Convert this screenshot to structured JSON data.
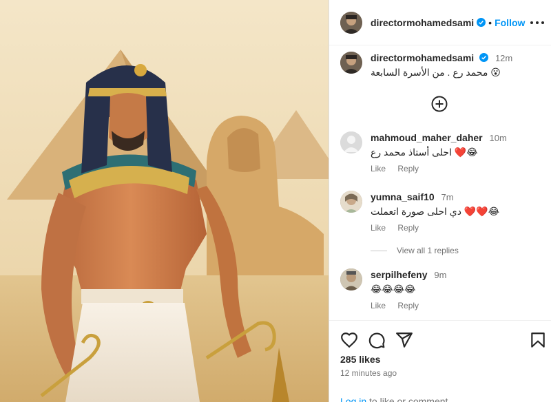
{
  "post": {
    "author": "directormohamedsami",
    "follow_label": "Follow",
    "separator": "•",
    "verified_icon": "verified-badge-icon",
    "more_icon": "more-options-icon",
    "image_description_icon": "photo"
  },
  "caption": {
    "username": "directormohamedsami",
    "time": "12m",
    "text": "محمد رع . من الأسرة السابعة",
    "emoji": "😮"
  },
  "load_more_icon": "plus-circle-icon",
  "comments": [
    {
      "username": "mahmoud_maher_daher",
      "time": "10m",
      "text": "احلى أستاذ محمد رع",
      "emojis": [
        "😂",
        "❤️"
      ],
      "like_label": "Like",
      "reply_label": "Reply"
    },
    {
      "username": "yumna_saif10",
      "time": "7m",
      "text": "دي احلى صورة اتعملت",
      "emojis": [
        "😂",
        "❤️",
        "❤️"
      ],
      "like_label": "Like",
      "reply_label": "Reply"
    },
    {
      "username": "serpilhefeny",
      "time": "9m",
      "text": "",
      "emojis": [
        "😂",
        "😂",
        "😂",
        "😂"
      ],
      "like_label": "Like",
      "reply_label": "Reply"
    }
  ],
  "view_replies": "View all 1 replies",
  "actions": {
    "like_icon": "heart-icon",
    "comment_icon": "comment-icon",
    "share_icon": "share-icon",
    "save_icon": "bookmark-icon"
  },
  "likes_text": "285 likes",
  "time_ago": "12 minutes ago",
  "footer": {
    "login_link": "Log in",
    "rest": " to like or comment."
  },
  "colors": {
    "accent": "#0095f6",
    "text": "#262626",
    "muted": "#737373",
    "heart": "#ed4956"
  }
}
